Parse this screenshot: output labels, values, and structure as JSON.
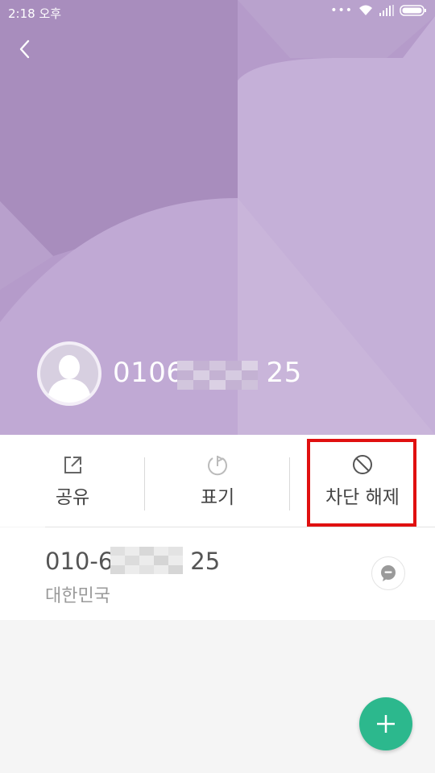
{
  "status_bar": {
    "time": "2:18 오후"
  },
  "contact": {
    "phone_display": "0106",
    "phone_display_end": "25"
  },
  "actions": [
    {
      "label": "공유",
      "icon": "share-icon"
    },
    {
      "label": "표기",
      "icon": "flag-icon"
    },
    {
      "label": "차단 해제",
      "icon": "unblock-icon"
    }
  ],
  "detail": {
    "number_start": "010-6",
    "number_end": "25",
    "region": "대한민국",
    "message_icon": "message-icon"
  },
  "fab": {
    "icon": "plus-icon"
  },
  "colors": {
    "header": "#b79ccc",
    "accent_fab": "#2cb88d",
    "highlight": "#e01010"
  }
}
